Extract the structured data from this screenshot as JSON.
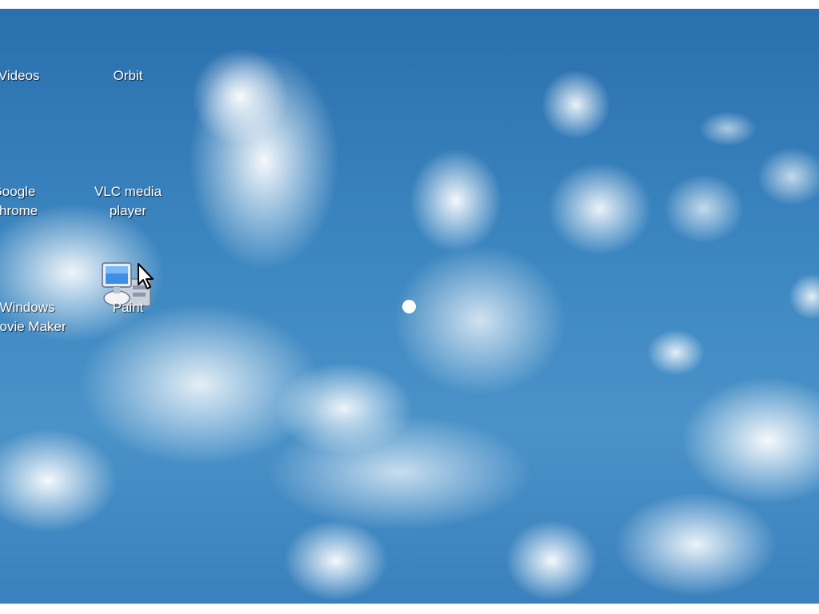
{
  "desktop": {
    "icons": [
      {
        "label_lines": [
          "My Videos"
        ]
      },
      {
        "label_lines": [
          "Orbit"
        ]
      },
      {
        "label_lines": [
          "Google",
          "Chrome"
        ]
      },
      {
        "label_lines": [
          "VLC media",
          "player"
        ]
      },
      {
        "label_lines": [
          "Windows",
          "Movie Maker"
        ]
      },
      {
        "label_lines": [
          "Paint"
        ],
        "icon": "paint-icon"
      }
    ],
    "cursor": "arrow-cursor-icon",
    "wallpaper": "cloudy-sky"
  },
  "colors": {
    "sky": "#3c86c0",
    "label_text": "#ffffff"
  }
}
